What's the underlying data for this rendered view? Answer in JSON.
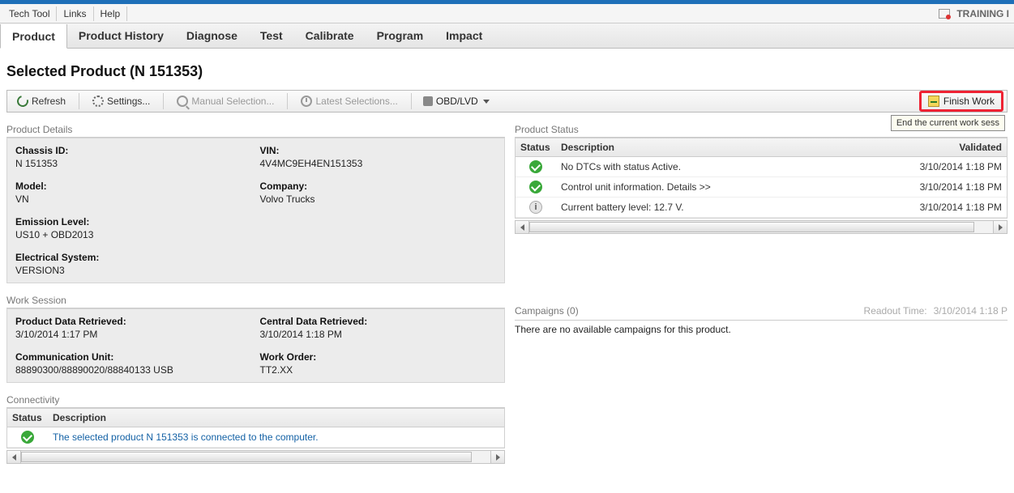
{
  "menubar": {
    "items": [
      "Tech Tool",
      "Links",
      "Help"
    ],
    "right": "TRAINING I"
  },
  "tabs": [
    "Product",
    "Product History",
    "Diagnose",
    "Test",
    "Calibrate",
    "Program",
    "Impact"
  ],
  "page_title": "Selected Product (N 151353)",
  "toolbar": {
    "refresh": "Refresh",
    "settings": "Settings...",
    "manual": "Manual Selection...",
    "latest": "Latest Selections...",
    "mode": "OBD/LVD",
    "finish": "Finish Work",
    "tooltip": "End the current work sess"
  },
  "details": {
    "heading": "Product Details",
    "chassis_lbl": "Chassis ID:",
    "chassis_val": "N 151353",
    "vin_lbl": "VIN:",
    "vin_val": "4V4MC9EH4EN151353",
    "model_lbl": "Model:",
    "model_val": "VN",
    "company_lbl": "Company:",
    "company_val": "Volvo Trucks",
    "emission_lbl": "Emission Level:",
    "emission_val": "US10 + OBD2013",
    "elec_lbl": "Electrical System:",
    "elec_val": "VERSION3"
  },
  "session": {
    "heading": "Work Session",
    "pdata_lbl": "Product Data Retrieved:",
    "pdata_val": "3/10/2014 1:17 PM",
    "cdata_lbl": "Central Data Retrieved:",
    "cdata_val": "3/10/2014 1:18 PM",
    "comm_lbl": "Communication Unit:",
    "comm_val": "88890300/88890020/88840133 USB",
    "order_lbl": "Work Order:",
    "order_val": "TT2.XX"
  },
  "connectivity": {
    "heading": "Connectivity",
    "th_status": "Status",
    "th_desc": "Description",
    "row": "The selected product N 151353 is connected to the computer."
  },
  "status": {
    "heading": "Product Status",
    "th_status": "Status",
    "th_desc": "Description",
    "th_val": "Validated",
    "rows": [
      {
        "kind": "ok",
        "desc": "No DTCs with status Active.",
        "val": "3/10/2014 1:18 PM"
      },
      {
        "kind": "ok",
        "desc": "Control unit information. Details >>",
        "val": "3/10/2014 1:18 PM"
      },
      {
        "kind": "info",
        "desc": "Current battery level: 12.7 V.",
        "val": "3/10/2014 1:18 PM"
      }
    ]
  },
  "campaigns": {
    "heading": "Campaigns   (0)",
    "readout_lbl": "Readout Time:",
    "readout_val": "3/10/2014 1:18 P",
    "empty": "There are no available campaigns for this product."
  }
}
